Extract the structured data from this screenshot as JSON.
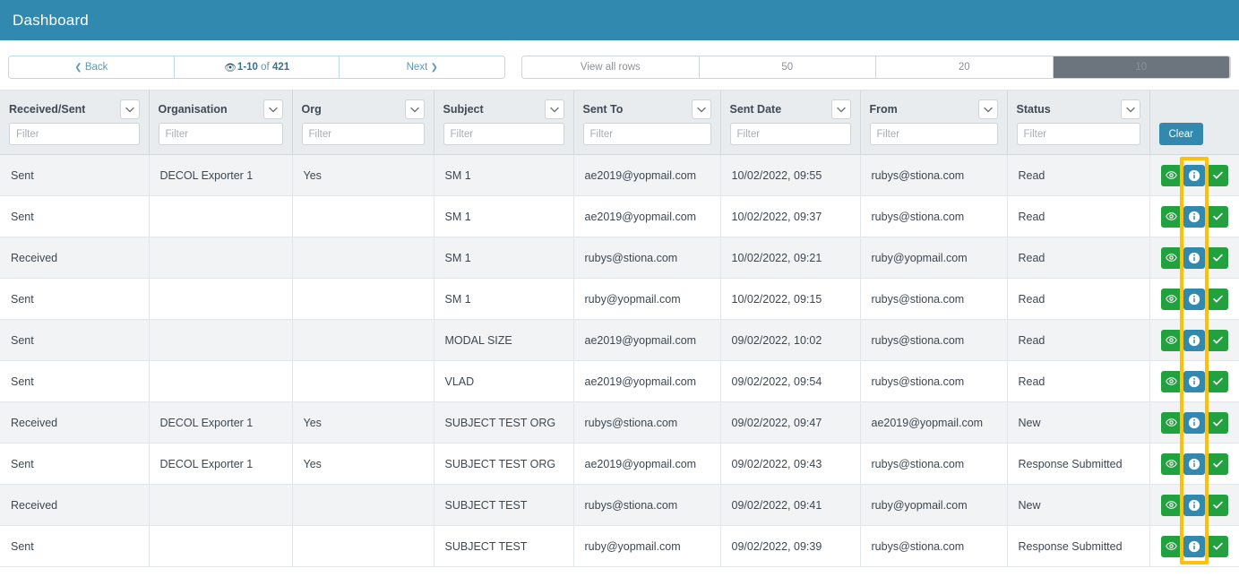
{
  "header": {
    "title": "Dashboard",
    "bg_color": "#3289b0"
  },
  "pagination": {
    "back_label": "Back",
    "back_icon": "chevron-left-icon",
    "range_icon": "eye-icon",
    "range_current": "1-10",
    "range_of": "of",
    "range_total": "421",
    "next_label": "Next",
    "next_icon": "chevron-right-icon",
    "view_all_label": "View all rows",
    "page_sizes": [
      "50",
      "20",
      "10"
    ],
    "active_page_size": "10"
  },
  "table": {
    "columns": [
      {
        "label": "Received/Sent",
        "filter_placeholder": "Filter"
      },
      {
        "label": "Organisation",
        "filter_placeholder": "Filter"
      },
      {
        "label": "Org",
        "filter_placeholder": "Filter"
      },
      {
        "label": "Subject",
        "filter_placeholder": "Filter"
      },
      {
        "label": "Sent To",
        "filter_placeholder": "Filter"
      },
      {
        "label": "Sent Date",
        "filter_placeholder": "Filter"
      },
      {
        "label": "From",
        "filter_placeholder": "Filter"
      },
      {
        "label": "Status",
        "filter_placeholder": "Filter"
      }
    ],
    "clear_label": "Clear",
    "filter_values": [
      "",
      "",
      "",
      "",
      "",
      "",
      "",
      ""
    ],
    "rows": [
      {
        "received_sent": "Sent",
        "organisation": "DECOL Exporter 1",
        "org": "Yes",
        "subject": "SM 1",
        "sent_to": "ae2019@yopmail.com",
        "sent_date": "10/02/2022, 09:55",
        "from": "rubys@stiona.com",
        "status": "Read"
      },
      {
        "received_sent": "Sent",
        "organisation": "",
        "org": "",
        "subject": "SM 1",
        "sent_to": "ae2019@yopmail.com",
        "sent_date": "10/02/2022, 09:37",
        "from": "rubys@stiona.com",
        "status": "Read"
      },
      {
        "received_sent": "Received",
        "organisation": "",
        "org": "",
        "subject": "SM 1",
        "sent_to": "rubys@stiona.com",
        "sent_date": "10/02/2022, 09:21",
        "from": "ruby@yopmail.com",
        "status": "Read"
      },
      {
        "received_sent": "Sent",
        "organisation": "",
        "org": "",
        "subject": "SM 1",
        "sent_to": "ruby@yopmail.com",
        "sent_date": "10/02/2022, 09:15",
        "from": "rubys@stiona.com",
        "status": "Read"
      },
      {
        "received_sent": "Sent",
        "organisation": "",
        "org": "",
        "subject": "MODAL SIZE",
        "sent_to": "ae2019@yopmail.com",
        "sent_date": "09/02/2022, 10:02",
        "from": "rubys@stiona.com",
        "status": "Read"
      },
      {
        "received_sent": "Sent",
        "organisation": "",
        "org": "",
        "subject": "VLAD",
        "sent_to": "ae2019@yopmail.com",
        "sent_date": "09/02/2022, 09:54",
        "from": "rubys@stiona.com",
        "status": "Read"
      },
      {
        "received_sent": "Received",
        "organisation": "DECOL Exporter 1",
        "org": "Yes",
        "subject": "SUBJECT TEST ORG",
        "sent_to": "rubys@stiona.com",
        "sent_date": "09/02/2022, 09:47",
        "from": "ae2019@yopmail.com",
        "status": "New"
      },
      {
        "received_sent": "Sent",
        "organisation": "DECOL Exporter 1",
        "org": "Yes",
        "subject": "SUBJECT TEST ORG",
        "sent_to": "ae2019@yopmail.com",
        "sent_date": "09/02/2022, 09:43",
        "from": "rubys@stiona.com",
        "status": "Response Submitted"
      },
      {
        "received_sent": "Received",
        "organisation": "",
        "org": "",
        "subject": "SUBJECT TEST",
        "sent_to": "rubys@stiona.com",
        "sent_date": "09/02/2022, 09:41",
        "from": "ruby@yopmail.com",
        "status": "New"
      },
      {
        "received_sent": "Sent",
        "organisation": "",
        "org": "",
        "subject": "SUBJECT TEST",
        "sent_to": "ruby@yopmail.com",
        "sent_date": "09/02/2022, 09:39",
        "from": "rubys@stiona.com",
        "status": "Response Submitted"
      }
    ],
    "row_actions": [
      {
        "name": "view-icon",
        "color": "#22a13f"
      },
      {
        "name": "info-icon",
        "color": "#3289b0"
      },
      {
        "name": "check-icon",
        "color": "#22a13f"
      }
    ]
  },
  "annotation": {
    "highlight_color": "#ffc107",
    "target": "info-action-column"
  }
}
